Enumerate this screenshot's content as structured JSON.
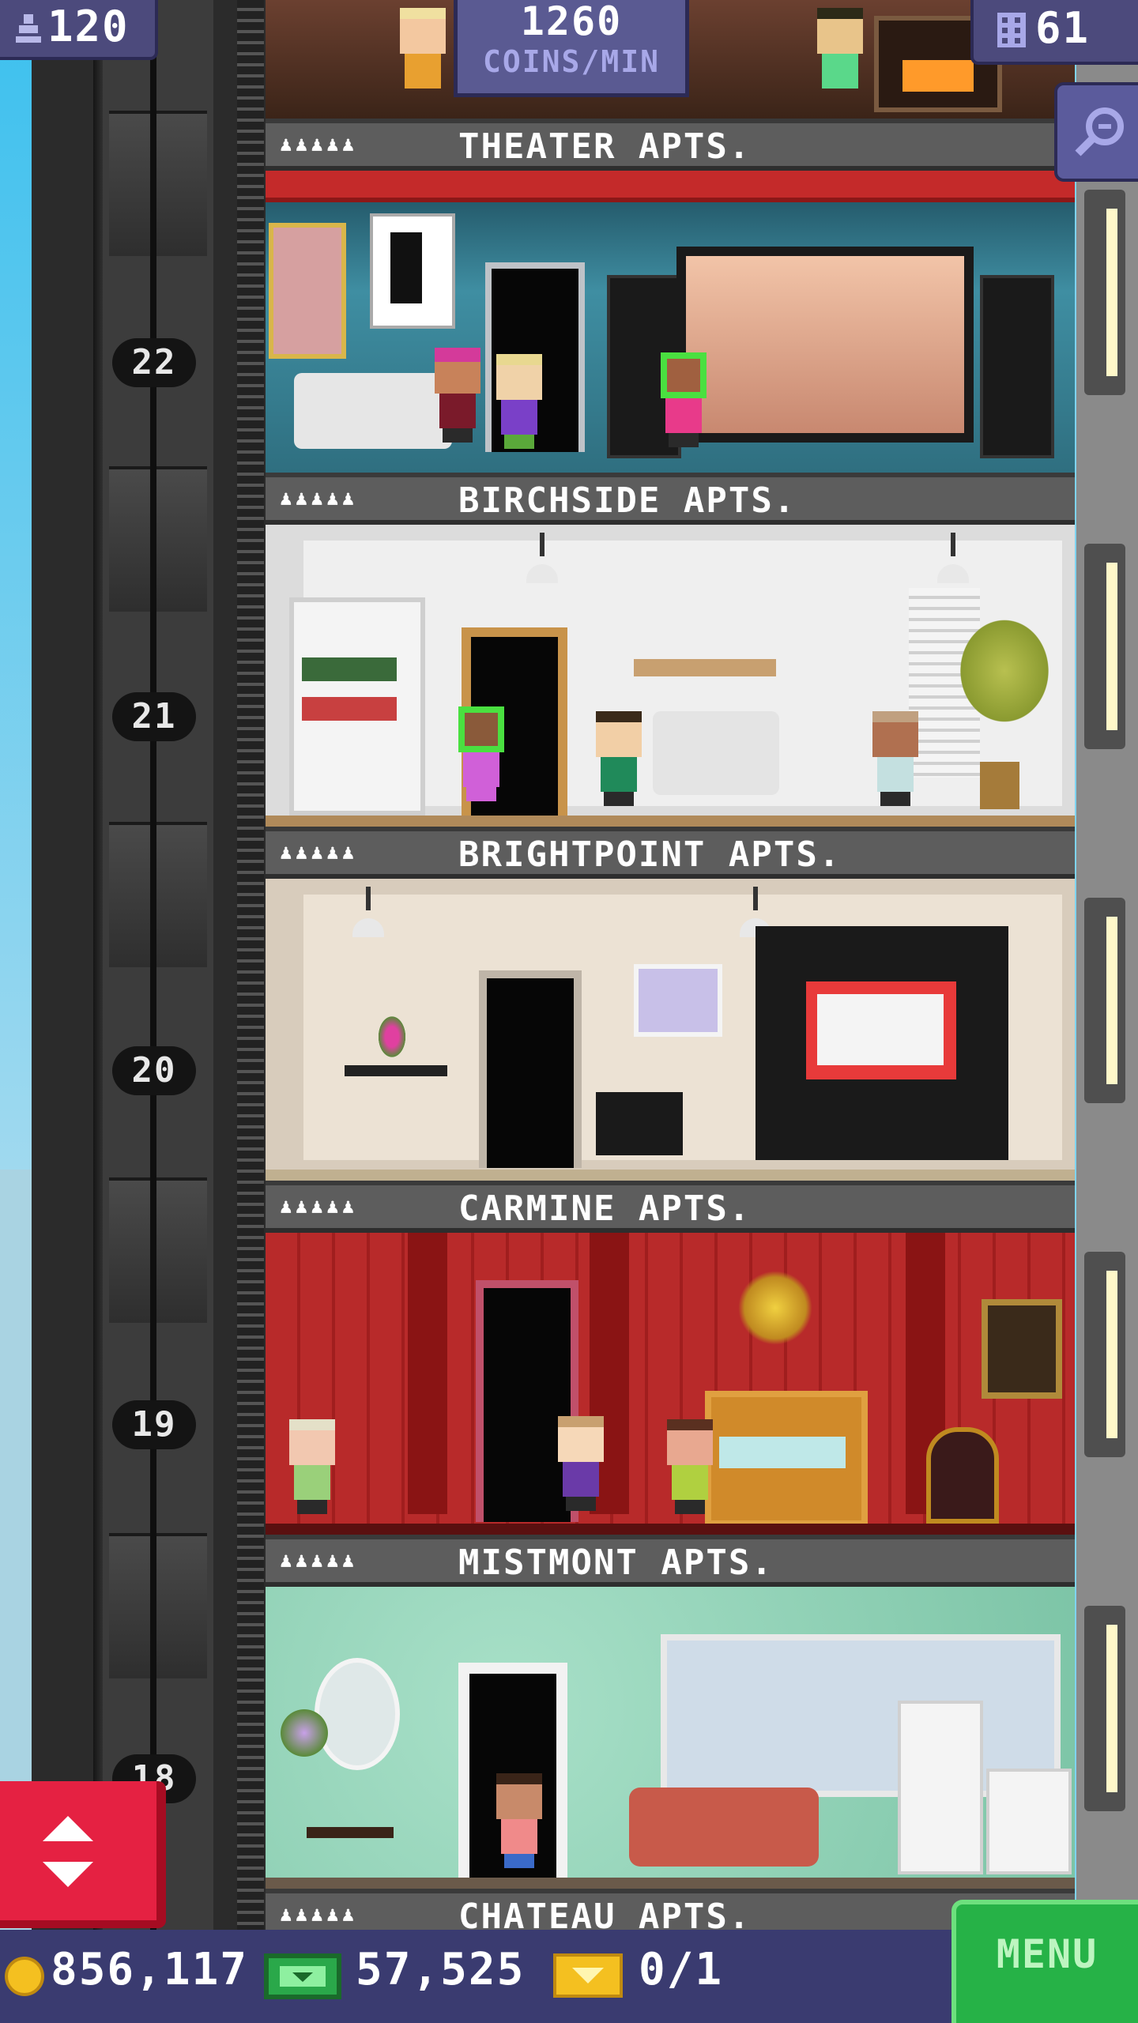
{
  "hud": {
    "population": "120",
    "coins_per_min_value": "1260",
    "coins_per_min_unit": "COINS/MIN",
    "floors": "61"
  },
  "floors": [
    {
      "name": "THEATER APTS.",
      "number": "22",
      "tenants": "♟♟♟♟♟"
    },
    {
      "name": "BIRCHSIDE APTS.",
      "number": "21",
      "tenants": "♟♟♟♟♟"
    },
    {
      "name": "BRIGHTPOINT APTS.",
      "number": "20",
      "tenants": "♟♟♟♟♟"
    },
    {
      "name": "CARMINE APTS.",
      "number": "19",
      "tenants": "♟♟♟♟♟"
    },
    {
      "name": "MISTMONT APTS.",
      "number": "18",
      "tenants": "♟♟♟♟♟"
    },
    {
      "name": "CHATEAU APTS.",
      "number": "",
      "tenants": "♟♟♟♟♟"
    }
  ],
  "bottom": {
    "coins": "856,117",
    "bux": "57,525",
    "tickets": "0/1",
    "menu_label": "MENU"
  },
  "icons": {
    "population": "person-icon",
    "floors": "building-icon",
    "zoom": "magnifier-icon",
    "coins": "coin-icon",
    "bux": "tower-bux-icon",
    "tickets": "vip-ticket-icon",
    "elevator": "elevator-updown-icon"
  },
  "colors": {
    "hud": "#4c4a7c",
    "menu": "#26b247",
    "elevator_button": "#e52142"
  }
}
